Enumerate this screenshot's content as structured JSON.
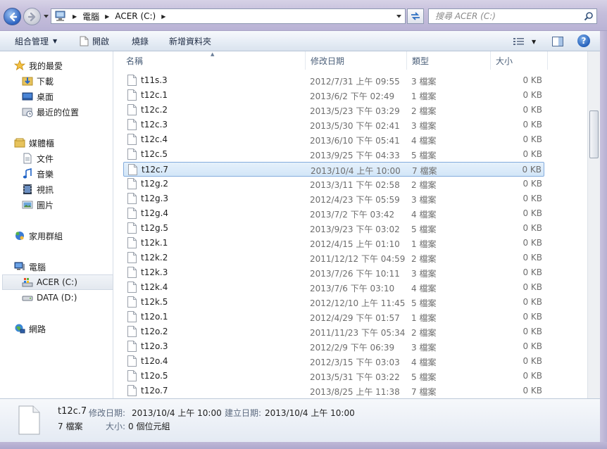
{
  "address": {
    "crumbs": [
      "電腦",
      "ACER (C:)"
    ],
    "search_placeholder": "搜尋 ACER (C:)"
  },
  "toolbar": {
    "organize": "組合管理",
    "open": "開啟",
    "burn": "燒錄",
    "new_folder": "新增資料夾"
  },
  "sidebar": {
    "favorites": {
      "label": "我的最愛",
      "items": [
        "下載",
        "桌面",
        "最近的位置"
      ]
    },
    "libraries": {
      "label": "媒體櫃",
      "items": [
        "文件",
        "音樂",
        "視訊",
        "圖片"
      ]
    },
    "homegroup": "家用群組",
    "computer": {
      "label": "電腦",
      "items": [
        "ACER (C:)",
        "DATA (D:)"
      ]
    },
    "network": "網路"
  },
  "columns": {
    "name": "名稱",
    "date": "修改日期",
    "type": "類型",
    "size": "大小"
  },
  "files": [
    {
      "name": "t11s.3",
      "date": "2012/7/31 上午 09:55",
      "type": "3 檔案",
      "size": "0 KB"
    },
    {
      "name": "t12c.1",
      "date": "2013/6/2 下午 02:49",
      "type": "1 檔案",
      "size": "0 KB"
    },
    {
      "name": "t12c.2",
      "date": "2013/5/23 下午 03:29",
      "type": "2 檔案",
      "size": "0 KB"
    },
    {
      "name": "t12c.3",
      "date": "2013/5/30 下午 02:41",
      "type": "3 檔案",
      "size": "0 KB"
    },
    {
      "name": "t12c.4",
      "date": "2013/6/10 下午 05:41",
      "type": "4 檔案",
      "size": "0 KB"
    },
    {
      "name": "t12c.5",
      "date": "2013/9/25 下午 04:33",
      "type": "5 檔案",
      "size": "0 KB"
    },
    {
      "name": "t12c.7",
      "date": "2013/10/4 上午 10:00",
      "type": "7 檔案",
      "size": "0 KB",
      "selected": true
    },
    {
      "name": "t12g.2",
      "date": "2013/3/11 下午 02:58",
      "type": "2 檔案",
      "size": "0 KB"
    },
    {
      "name": "t12g.3",
      "date": "2012/4/23 下午 05:59",
      "type": "3 檔案",
      "size": "0 KB"
    },
    {
      "name": "t12g.4",
      "date": "2013/7/2 下午 03:42",
      "type": "4 檔案",
      "size": "0 KB"
    },
    {
      "name": "t12g.5",
      "date": "2013/9/23 下午 03:02",
      "type": "5 檔案",
      "size": "0 KB"
    },
    {
      "name": "t12k.1",
      "date": "2012/4/15 上午 01:10",
      "type": "1 檔案",
      "size": "0 KB"
    },
    {
      "name": "t12k.2",
      "date": "2011/12/12 下午 04:59",
      "type": "2 檔案",
      "size": "0 KB"
    },
    {
      "name": "t12k.3",
      "date": "2013/7/26 下午 10:11",
      "type": "3 檔案",
      "size": "0 KB"
    },
    {
      "name": "t12k.4",
      "date": "2013/7/6 下午 03:10",
      "type": "4 檔案",
      "size": "0 KB"
    },
    {
      "name": "t12k.5",
      "date": "2012/12/10 上午 11:45",
      "type": "5 檔案",
      "size": "0 KB"
    },
    {
      "name": "t12o.1",
      "date": "2012/4/29 下午 01:57",
      "type": "1 檔案",
      "size": "0 KB"
    },
    {
      "name": "t12o.2",
      "date": "2011/11/23 下午 05:34",
      "type": "2 檔案",
      "size": "0 KB"
    },
    {
      "name": "t12o.3",
      "date": "2012/2/9 下午 06:39",
      "type": "3 檔案",
      "size": "0 KB"
    },
    {
      "name": "t12o.4",
      "date": "2012/3/15 下午 03:03",
      "type": "4 檔案",
      "size": "0 KB"
    },
    {
      "name": "t12o.5",
      "date": "2013/5/31 下午 03:22",
      "type": "5 檔案",
      "size": "0 KB"
    },
    {
      "name": "t12o.7",
      "date": "2013/8/25 上午 11:38",
      "type": "7 檔案",
      "size": "0 KB"
    }
  ],
  "details": {
    "name": "t12c.7",
    "modified_label": "修改日期:",
    "modified_value": "2013/10/4 上午 10:00",
    "created_label": "建立日期:",
    "created_value": "2013/10/4 上午 10:00",
    "type": "7 檔案",
    "size_label": "大小:",
    "size_value": "0 個位元組"
  }
}
